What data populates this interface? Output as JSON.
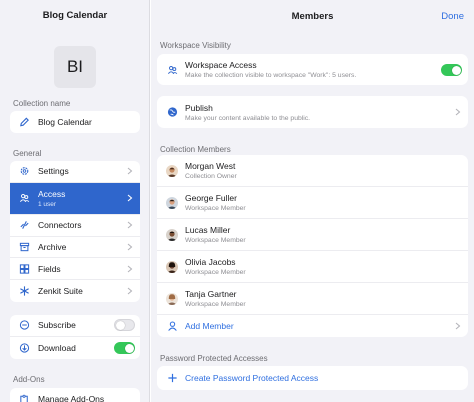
{
  "sidebar": {
    "title": "Blog Calendar",
    "initials": "BI",
    "collection_name_label": "Collection name",
    "collection_name_value": "Blog Calendar",
    "general_label": "General",
    "items": [
      {
        "label": "Settings"
      },
      {
        "label": "Access",
        "sub": "1 user",
        "active": true
      },
      {
        "label": "Connectors"
      },
      {
        "label": "Archive"
      },
      {
        "label": "Fields"
      },
      {
        "label": "Zenkit Suite"
      }
    ],
    "toggles": [
      {
        "label": "Subscribe",
        "on": false
      },
      {
        "label": "Download",
        "on": true
      }
    ],
    "addons_label": "Add-Ons",
    "manage_addons": "Manage Add-Ons"
  },
  "panel": {
    "title": "Members",
    "done": "Done",
    "visibility_label": "Workspace Visibility",
    "workspace_access": {
      "title": "Workspace Access",
      "subtitle": "Make the collection visible to workspace \"Work\": 5 users.",
      "on": true
    },
    "publish": {
      "title": "Publish",
      "subtitle": "Make your content available to the public."
    },
    "members_label": "Collection Members",
    "members": [
      {
        "name": "Morgan West",
        "role": "Collection Owner"
      },
      {
        "name": "George Fuller",
        "role": "Workspace Member"
      },
      {
        "name": "Lucas Miller",
        "role": "Workspace Member"
      },
      {
        "name": "Olivia Jacobs",
        "role": "Workspace Member"
      },
      {
        "name": "Tanja Gartner",
        "role": "Workspace Member"
      }
    ],
    "add_member": "Add Member",
    "password_label": "Password Protected Accesses",
    "create_password": "Create Password Protected Access"
  },
  "colors": {
    "accent": "#2f66cc",
    "link": "#2f6fe0",
    "toggle_on": "#34c759"
  }
}
